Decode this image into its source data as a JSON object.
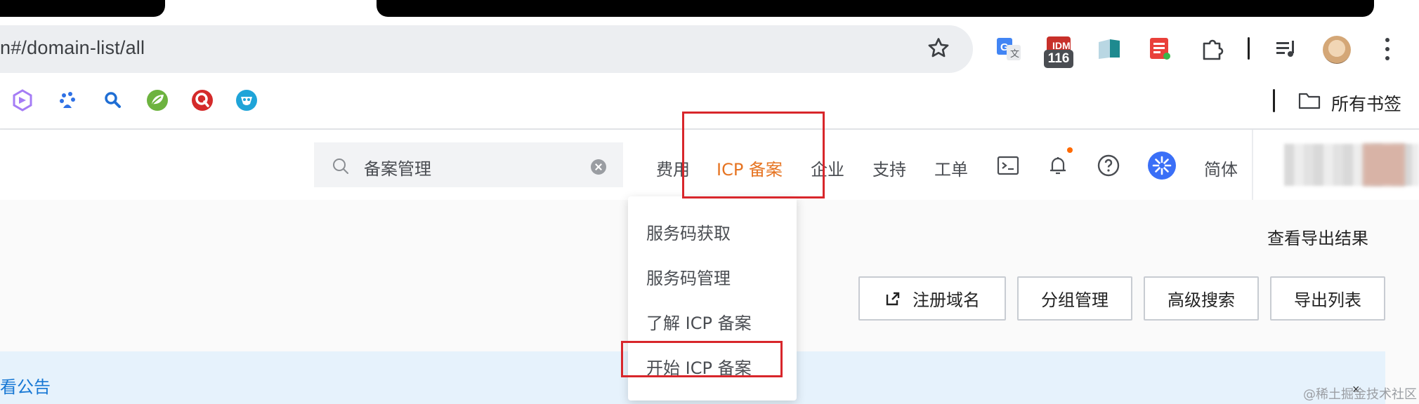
{
  "browser": {
    "url": "n#/domain-list/all",
    "extension_badge": "116",
    "bookmarks_folder_label": "所有书签"
  },
  "console_header": {
    "search": {
      "value": "备案管理"
    },
    "nav": [
      {
        "label": "费用",
        "active": false
      },
      {
        "label": "ICP 备案",
        "active": true
      },
      {
        "label": "企业",
        "active": false
      },
      {
        "label": "支持",
        "active": false
      },
      {
        "label": "工单",
        "active": false
      }
    ],
    "language": "简体",
    "accent_color": "#e67422"
  },
  "icp_dropdown": {
    "items": [
      {
        "label": "服务码获取"
      },
      {
        "label": "服务码管理"
      },
      {
        "label": "了解 ICP 备案"
      },
      {
        "label": "开始 ICP 备案"
      }
    ]
  },
  "main": {
    "export_result_link": "查看导出结果",
    "buttons": [
      {
        "label": "注册域名",
        "icon": "external-link-icon"
      },
      {
        "label": "分组管理"
      },
      {
        "label": "高级搜索"
      },
      {
        "label": "导出列表"
      }
    ],
    "notice_text": "看公告",
    "notice_close": "×"
  },
  "watermark": "@稀土掘金技术社区",
  "annotation_color": "#d8262b"
}
